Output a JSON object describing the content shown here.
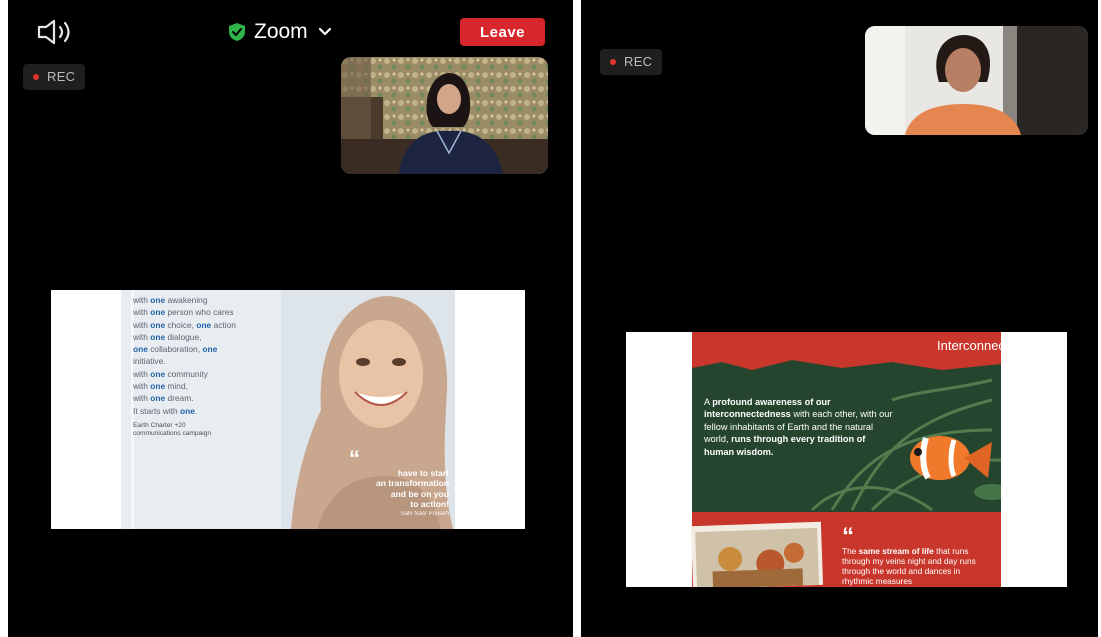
{
  "left_screen": {
    "app_title": "Zoom",
    "leave_label": "Leave",
    "rec_label": "REC",
    "icons": {
      "speaker": "speaker-icon",
      "security": "shield-check-icon",
      "menu": "chevron-down-icon"
    },
    "colors": {
      "leave": "#d7262c",
      "security": "#2fb34a",
      "rec_dot": "#e0352d"
    },
    "slide": {
      "lines": [
        {
          "pre": "with ",
          "em": "one",
          "post": " awakening"
        },
        {
          "pre": "with ",
          "em": "one",
          "post": " person who cares"
        },
        {
          "pre": "with ",
          "em": "one",
          "post": " choice, ",
          "em2": "one",
          "post2": " action"
        },
        {
          "pre": "with ",
          "em": "one",
          "post": " dialogue,"
        },
        {
          "pre": "",
          "em": "one",
          "post": " collaboration, ",
          "em2": "one",
          "post2": ""
        },
        {
          "pre": "initiative.",
          "em": "",
          "post": ""
        },
        {
          "pre": "with ",
          "em": "one",
          "post": " community"
        },
        {
          "pre": "with ",
          "em": "one",
          "post": " mind,"
        },
        {
          "pre": "with ",
          "em": "one",
          "post": " dream."
        },
        {
          "pre": "It starts with ",
          "em": "one",
          "post": "."
        }
      ],
      "credit_1": "Earth Charter +20",
      "credit_2": "communications campaign",
      "quote_mark": "“",
      "quote_lines": [
        "have to start",
        "an transformation",
        "and be on you",
        "to action!"
      ],
      "quote_author": "Sahi Nasr Pouseh"
    }
  },
  "right_screen": {
    "rec_label": "REC",
    "slide": {
      "title": "Interconnection",
      "body": [
        {
          "text": "A ",
          "bold": false
        },
        {
          "text": "profound awareness of our interconnectedness",
          "bold": true
        },
        {
          "text": " with each other, with our fellow inhabitants of Earth and the natural world, ",
          "bold": false
        },
        {
          "text": "runs through every tradition of human wisdom.",
          "bold": true
        }
      ],
      "quote_mark": "“",
      "quote": [
        {
          "text": "The ",
          "bold": false
        },
        {
          "text": "same stream of life",
          "bold": true
        },
        {
          "text": " that runs through my veins night and day runs through the world and dances in rhythmic measures",
          "bold": false
        }
      ]
    }
  }
}
